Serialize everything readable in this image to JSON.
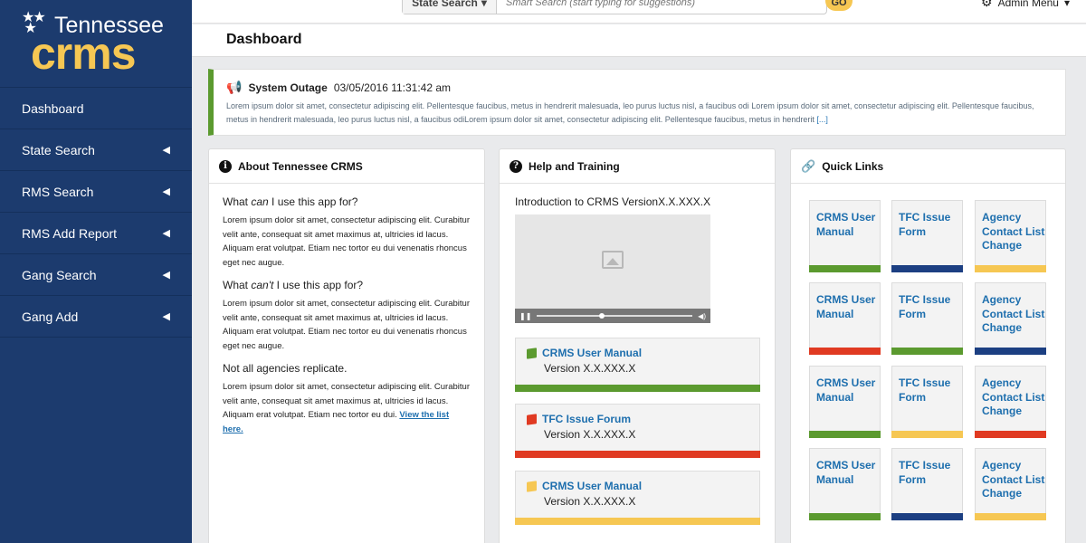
{
  "colors": {
    "sidebar": "#1c3b6e",
    "accent_gold": "#f6c753",
    "green": "#5b9a2f",
    "navy": "#1c3f82",
    "red": "#e03a22",
    "yellow": "#f6c753",
    "link": "#1e6fae"
  },
  "logo": {
    "state": "Tennessee",
    "app": "crms"
  },
  "sidebar": {
    "items": [
      {
        "label": "Dashboard",
        "has_arrow": false
      },
      {
        "label": "State Search",
        "has_arrow": true
      },
      {
        "label": "RMS Search",
        "has_arrow": true
      },
      {
        "label": "RMS Add Report",
        "has_arrow": true
      },
      {
        "label": "Gang Search",
        "has_arrow": true
      },
      {
        "label": "Gang Add",
        "has_arrow": true
      }
    ]
  },
  "topbar": {
    "search_scope": "State Search",
    "search_placeholder": "Smart Search (start typing for suggestions)",
    "go_label": "GO",
    "admin_label": "Admin Menu"
  },
  "page": {
    "title": "Dashboard"
  },
  "alert": {
    "title": "System Outage",
    "timestamp": "03/05/2016 11:31:42 am",
    "body": "Lorem ipsum dolor sit amet, consectetur adipiscing elit. Pellentesque faucibus, metus in hendrerit malesuada, leo purus luctus nisl, a faucibus odi Lorem ipsum dolor sit amet, consectetur adipiscing elit. Pellentesque faucibus, metus in hendrerit malesuada, leo purus luctus nisl, a faucibus odiLorem ipsum dolor sit amet, consectetur adipiscing elit. Pellentesque faucibus, metus in hendrerit",
    "more": "[...]"
  },
  "about": {
    "title": "About Tennessee CRMS",
    "q1_pre": "What ",
    "q1_em": "can",
    "q1_post": " I use this app for?",
    "p1": "Lorem ipsum dolor sit amet, consectetur adipiscing elit. Curabitur velit ante, consequat sit amet maximus at, ultricies id lacus. Aliquam erat volutpat. Etiam nec tortor eu dui venenatis rhoncus eget nec augue.",
    "q2_pre": "What ",
    "q2_em": "can't",
    "q2_post": " I use this app for?",
    "p2": "Lorem ipsum dolor sit amet, consectetur adipiscing elit. Curabitur velit ante, consequat sit amet maximus at, ultricies id lacus. Aliquam erat volutpat. Etiam nec tortor eu dui venenatis rhoncus eget nec augue.",
    "q3": "Not all agencies replicate.",
    "p3": "Lorem ipsum dolor sit amet, consectetur adipiscing elit. Curabitur velit ante, consequat sit amet maximus at, ultricies id lacus. Aliquam erat volutpat. Etiam nec tortor eu dui. ",
    "p3_link": "View the list here."
  },
  "help": {
    "title": "Help and Training",
    "video_title": "Introduction to CRMS VersionX.X.XXX.X",
    "video_progress": 0.4,
    "docs": [
      {
        "title": "CRMS User Manual",
        "version": "Version X.X.XXX.X",
        "color": "#5b9a2f"
      },
      {
        "title": "TFC Issue Forum",
        "version": "Version X.X.XXX.X",
        "color": "#e03a22"
      },
      {
        "title": "CRMS User Manual",
        "version": "Version X.X.XXX.X",
        "color": "#f6c753"
      }
    ]
  },
  "links": {
    "title": "Quick Links",
    "rows": [
      [
        {
          "label": "CRMS User Manual",
          "color": "#5b9a2f"
        },
        {
          "label": "TFC Issue Form",
          "color": "#1c3f82"
        },
        {
          "label": "Agency Contact List Change",
          "color": "#f6c753"
        }
      ],
      [
        {
          "label": "CRMS User Manual",
          "color": "#e03a22"
        },
        {
          "label": "TFC Issue Form",
          "color": "#5b9a2f"
        },
        {
          "label": "Agency Contact List Change",
          "color": "#1c3f82"
        }
      ],
      [
        {
          "label": "CRMS User Manual",
          "color": "#5b9a2f"
        },
        {
          "label": "TFC Issue Form",
          "color": "#f6c753"
        },
        {
          "label": "Agency Contact List Change",
          "color": "#e03a22"
        }
      ],
      [
        {
          "label": "CRMS User Manual",
          "color": "#5b9a2f"
        },
        {
          "label": "TFC Issue Form",
          "color": "#1c3f82"
        },
        {
          "label": "Agency Contact List Change",
          "color": "#f6c753"
        }
      ]
    ]
  }
}
